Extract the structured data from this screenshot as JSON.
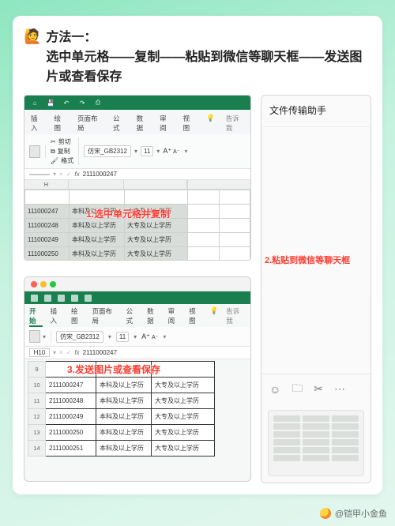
{
  "heading_emoji": "🙋",
  "heading": "方法一：\n选中单元格——复制——粘贴到微信等聊天框——发送图片或查看保存",
  "annotations": {
    "step1": "1.选中单元格并复制",
    "step2": "2.粘贴到微信等聊天框",
    "step3": "3.发送图片或查看保存"
  },
  "excel1": {
    "tabs": [
      "插入",
      "绘图",
      "页面布局",
      "公式",
      "数据",
      "审阅",
      "视图"
    ],
    "tell_me": "告诉我",
    "clip": {
      "cut": "剪切",
      "copy": "复制",
      "format": "格式"
    },
    "font_name": "仿宋_GB2312",
    "font_size": "11",
    "formula_cell": "",
    "fx_label": "fx",
    "formula_value": "2111000247",
    "col_headers": [
      "H",
      "",
      "",
      "",
      ""
    ],
    "rows": [
      {
        "a": "",
        "b": "",
        "c": "",
        "sel": false
      },
      {
        "a": "111000247",
        "b": "本科及以上学历",
        "c": "大专及以上学历",
        "sel": true
      },
      {
        "a": "111000248",
        "b": "本科及以上学历",
        "c": "大专及以上学历",
        "sel": true
      },
      {
        "a": "111000249",
        "b": "本科及以上学历",
        "c": "大专及以上学历",
        "sel": true
      },
      {
        "a": "111000250",
        "b": "本科及以上学历",
        "c": "大专及以上学历",
        "sel": true
      }
    ]
  },
  "wechat": {
    "title": "文件传输助手"
  },
  "excel2": {
    "tabs": [
      "开始",
      "插入",
      "绘图",
      "页面布局",
      "公式",
      "数据",
      "审阅",
      "视图"
    ],
    "tell_me": "告诉我",
    "font_name": "仿宋_GB2312",
    "font_size": "11",
    "formula_cell": "H10",
    "fx_label": "fx",
    "formula_value": "2111000247",
    "row_start": 9,
    "rows": [
      {
        "a": "",
        "b": "",
        "c": ""
      },
      {
        "a": "2111000247",
        "b": "本科及以上学历",
        "c": "大专及以上学历"
      },
      {
        "a": "2111000248",
        "b": "本科及以上学历",
        "c": "大专及以上学历"
      },
      {
        "a": "2111000249",
        "b": "本科及以上学历",
        "c": "大专及以上学历"
      },
      {
        "a": "2111000250",
        "b": "本科及以上学历",
        "c": "大专及以上学历"
      },
      {
        "a": "2111000251",
        "b": "本科及以上学历",
        "c": "大专及以上学历"
      }
    ]
  },
  "watermark": "@铠甲小金鱼"
}
